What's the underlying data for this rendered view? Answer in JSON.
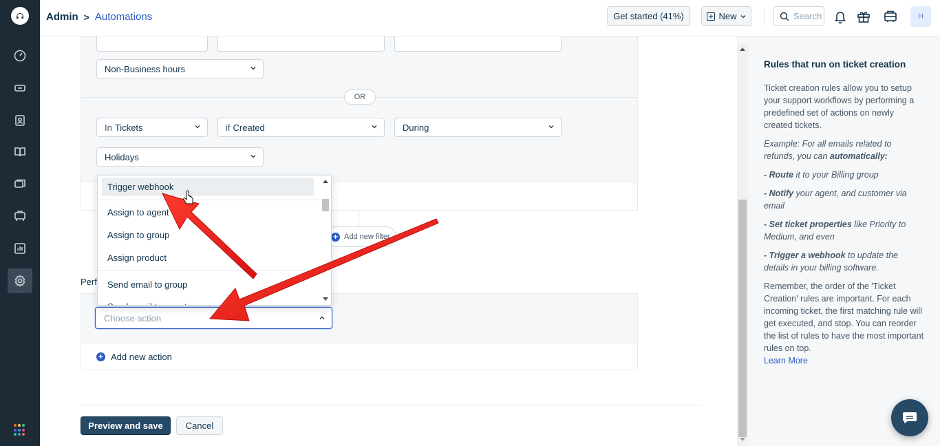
{
  "header": {
    "breadcrumb_root": "Admin",
    "breadcrumb_sep": ">",
    "breadcrumb_current": "Automations",
    "get_started": "Get started (41%)",
    "new_label": "New",
    "search_placeholder": "Search",
    "avatar_initial": "H"
  },
  "conditions": {
    "group1_value": "Non-Business hours",
    "or_label": "OR",
    "row2": {
      "in_prefix": "In",
      "in_value": "Tickets",
      "if_prefix": "if",
      "if_value": "Created",
      "during": "During",
      "value": "Holidays"
    },
    "add_filter": "Add new filter"
  },
  "actions": {
    "section_label": "Perf",
    "choose_action_placeholder": "Choose action",
    "add_action": "Add new action"
  },
  "dropdown": {
    "items": [
      "Trigger webhook",
      "Assign to agent",
      "Assign to group",
      "Assign product",
      "Send email to group",
      "Send email to agent"
    ]
  },
  "footer": {
    "preview_save": "Preview and save",
    "cancel": "Cancel"
  },
  "help": {
    "title": "Rules that run on ticket creation",
    "intro": "Ticket creation rules allow you to setup your support workflows by performing a predefined set of actions on newly created tickets.",
    "example_a": "Example: For all emails related to refunds, you can ",
    "example_b": "automatically:",
    "b1_dash": "- ",
    "b1_bold": "Route",
    "b1_rest": " it to your Billing group",
    "b2_bold": "Notify",
    "b2_rest": " your agent, and customer via email",
    "b3_bold": "Set ticket properties",
    "b3_rest": " like Priority to Medium, and even",
    "b4_bold": "Trigger a webhook",
    "b4_rest": " to update the details in your billing software.",
    "order": "Remember, the order of the 'Ticket Creation' rules are important. For each incoming ticket, the first matching rule will get executed, and stop. You can reorder the list of rules to have the most important rules on top.",
    "learn_more": "Learn More"
  },
  "colors": {
    "nav_bg": "#1c2b36",
    "accent": "#2c5cc5",
    "primary_btn": "#264966",
    "annotation_arrow": "#e8201b"
  }
}
